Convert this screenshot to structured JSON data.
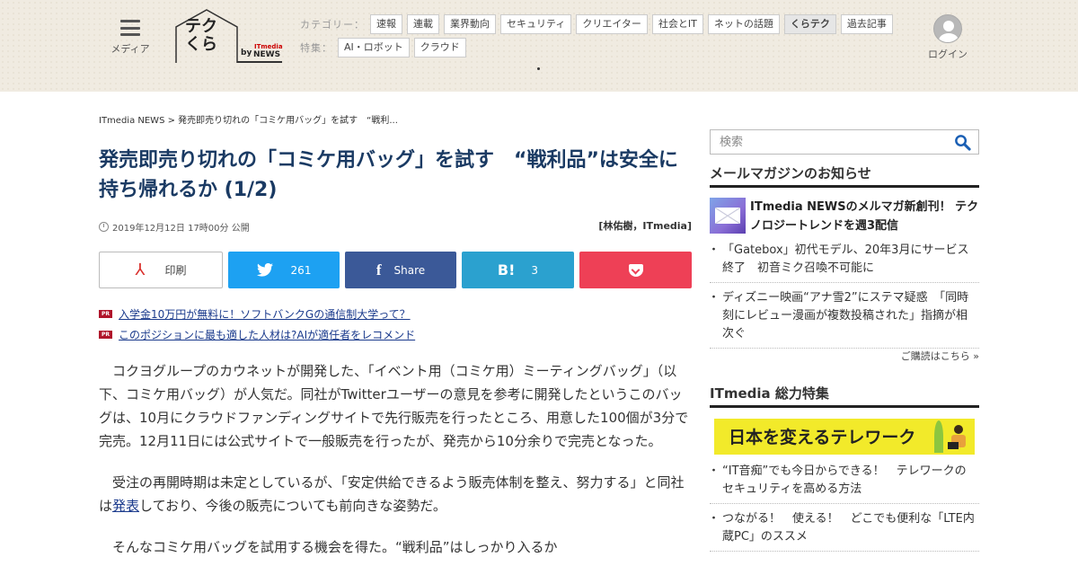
{
  "header": {
    "menu_label": "メディア",
    "logo": {
      "name": "テクくら",
      "by": "by",
      "brand_top": "ITmedia",
      "brand_bottom": "NEWS"
    },
    "category_label": "カテゴリー：",
    "categories": [
      "速報",
      "連載",
      "業界動向",
      "セキュリティ",
      "クリエイター",
      "社会とIT",
      "ネットの話題",
      "くらテク",
      "過去記事"
    ],
    "active_category": "くらテク",
    "feature_label": "特集：",
    "features": [
      "AI・ロボット",
      "クラウド"
    ],
    "login_label": "ログイン"
  },
  "article": {
    "breadcrumb": "ITmedia NEWS > 発売即売り切れの「コミケ用バッグ」を試す　“戦利...",
    "title": "発売即売り切れの「コミケ用バッグ」を試す　“戦利品”は安全に持ち帰れるか (1/2)",
    "date": "2019年12月12日 17時00分 公開",
    "author": "[林佑樹，ITmedia]",
    "share": {
      "print": "印刷",
      "twitter_count": "261",
      "facebook": "Share",
      "hatena_icon": "B!",
      "hatena_count": "3"
    },
    "pr_badge": "PR",
    "pr_links": [
      "入学金10万円が無料に！ソフトバンクGの通信制大学って？",
      "このポジションに最も適した人材は?AIが適任者をレコメンド"
    ],
    "paragraph1": "コクヨグループのカウネットが開発した、「イベント用（コミケ用）ミーティングバッグ」（以下、コミケ用バッグ）が人気だ。同社がTwitterユーザーの意見を参考に開発したというこのバッグは、10月にクラウドファンディングサイトで先行販売を行ったところ、用意した100個が3分で完売。12月11日には公式サイトで一般販売を行ったが、発売から10分余りで完売となった。",
    "paragraph2_pre": "受注の再開時期は未定としているが、「安定供給できるよう販売体制を整え、努力する」と同社は",
    "paragraph2_link": "発表",
    "paragraph2_post": "しており、今後の販売についても前向きな姿勢だ。",
    "paragraph3": "そんなコミケ用バッグを試用する機会を得た。“戦利品”はしっかり入るか"
  },
  "sidebar": {
    "search_placeholder": "検索",
    "mailmag_heading": "メールマガジンのお知らせ",
    "mailmag_feature": "ITmedia NEWSのメルマガ新創刊！ テクノロジートレンドを週3配信",
    "mailmag_items": [
      "「Gatebox」初代モデル、20年3月にサービス終了　初音ミク召喚不可能に",
      "ディズニー映画“アナ雪2”にステマ疑惑　「同時刻にレビュー漫画が複数投稿された」指摘が相次ぐ"
    ],
    "subscribe_link": "ご購読はこちら »",
    "special_heading": "ITmedia 総力特集",
    "banner_text": "日本を変えるテレワーク",
    "special_items": [
      "“IT音痴”でも今日からできる！　テレワークのセキュリティを高める方法",
      "つながる！　使える！　どこでも便利な「LTE内蔵PC」のススメ"
    ]
  },
  "colors": {
    "title": "#1a3a63",
    "twitter": "#1da1f2",
    "facebook": "#3b5998",
    "hatena": "#2ba1cf",
    "pocket": "#ee4056",
    "pr_badge": "#b0152b",
    "banner": "#f2ea2a"
  }
}
